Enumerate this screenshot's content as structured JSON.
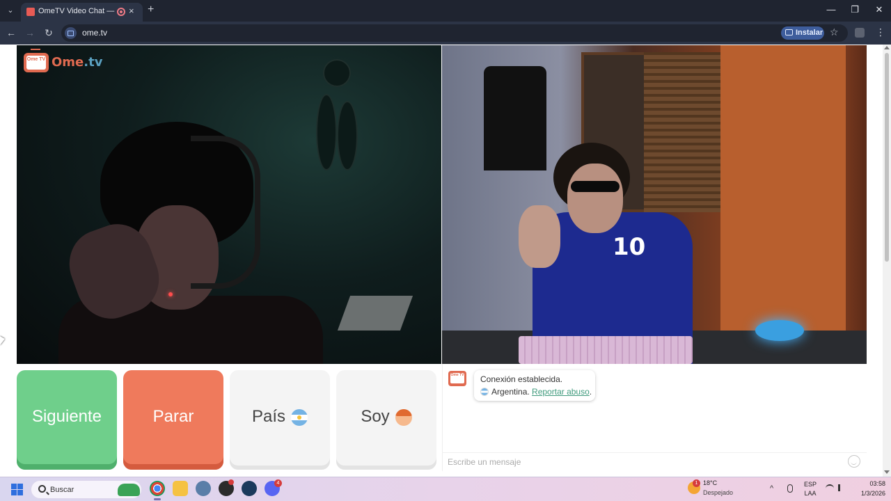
{
  "browser": {
    "tab_title": "OmeTV Video Chat — Ome",
    "tab_close": "×",
    "new_tab": "+",
    "tab_menu": "⌄",
    "url": "ome.tv",
    "install_label": "Instalar",
    "window_controls": {
      "minimize": "—",
      "maximize": "❐",
      "close": "✕"
    },
    "nav": {
      "back": "←",
      "forward": "→",
      "reload": "↻",
      "star": "☆",
      "menu": "⋮"
    }
  },
  "logo": {
    "tv_text": "Ome TV",
    "brand_main": "Ome",
    "brand_suffix": ".tv"
  },
  "videos": {
    "right_jersey_number": "10"
  },
  "controls": {
    "next_label": "Siguiente",
    "stop_label": "Parar",
    "country_label": "País",
    "soy_label": "Soy"
  },
  "chat": {
    "logo_text": "Ome TV",
    "status_message": "Conexión establecida.",
    "country_text": "Argentina.",
    "report_link": "Reportar abuso",
    "report_suffix": ".",
    "input_placeholder": "Escribe un mensaje"
  },
  "taskbar": {
    "search_placeholder": "Buscar",
    "weather": {
      "temperature": "18°C",
      "description": "Despejado",
      "badge": "1"
    },
    "language": "ESP",
    "layout": "LAA",
    "time": "03:58",
    "date": "1/3/2026",
    "discord_badge": "4",
    "tray_chevron": "^"
  },
  "colors": {
    "next_button": "#6fcf8b",
    "stop_button": "#ef7a5c",
    "brand": "#e06a50",
    "link": "#3f9a7c"
  },
  "icons": {
    "tab_favicon": "ometv-icon",
    "site_info": "video-camera-icon",
    "install": "install-app-icon",
    "emoji": "smiley-icon",
    "taskbar_apps": [
      "windows-start-icon",
      "chrome-icon",
      "file-explorer-icon",
      "settings-icon",
      "obs-icon",
      "steam-icon",
      "discord-icon"
    ]
  }
}
